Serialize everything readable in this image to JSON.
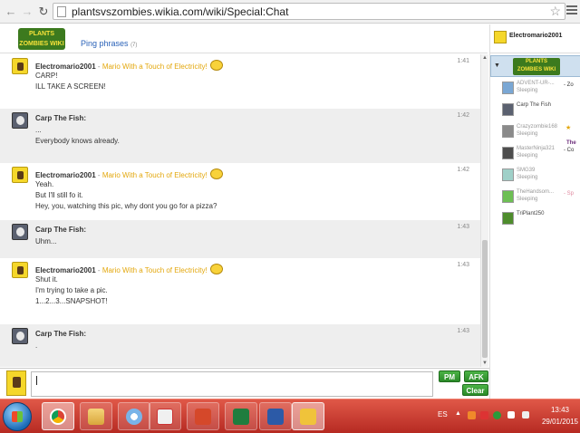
{
  "browser": {
    "url": "plantsvszombies.wikia.com/wiki/Special:Chat"
  },
  "header": {
    "logo_text_1": "PLANTS",
    "logo_text_2": "ZOMBIES WIKI",
    "ping_label": "Ping phrases",
    "ping_count": "(7)"
  },
  "messages": [
    {
      "user": "Electromario2001",
      "status": "Mario With a Touch of Electricity!",
      "time": "1:41",
      "lines": [
        "CARP!",
        "ILL TAKE A SCREEN!"
      ],
      "avatar": "mario-avatar",
      "shaded": false
    },
    {
      "user": "Carp The Fish:",
      "status": "",
      "time": "1:42",
      "lines": [
        "...",
        "Everybody knows already."
      ],
      "avatar": "carp-avatar",
      "shaded": true
    },
    {
      "user": "Electromario2001",
      "status": "Mario With a Touch of Electricity!",
      "time": "1:42",
      "lines": [
        "Yeah.",
        "But I'll still fo it.",
        "Hey, you, watching this pic, why dont you go for a pizza?"
      ],
      "avatar": "mario-avatar",
      "shaded": false
    },
    {
      "user": "Carp The Fish:",
      "status": "",
      "time": "1:43",
      "lines": [
        "Uhm..."
      ],
      "avatar": "carp-avatar",
      "shaded": true
    },
    {
      "user": "Electromario2001",
      "status": "Mario With a Touch of Electricity!",
      "time": "1:43",
      "lines": [
        "Shut it.",
        "I'm trying to take a pic.",
        "1...2...3...SNAPSHOT!"
      ],
      "avatar": "mario-avatar",
      "shaded": false
    },
    {
      "user": "Carp The Fish:",
      "status": "",
      "time": "1:43",
      "lines": [
        "."
      ],
      "avatar": "carp-avatar",
      "shaded": true
    }
  ],
  "input": {
    "value": "",
    "pm_label": "PM",
    "afk_label": "AFK",
    "clear_label": "Clear"
  },
  "sidebar": {
    "me_name": "Electromario2001",
    "room_logo_1": "PLANTS",
    "room_logo_2": "ZOMBIES WIKI",
    "users": [
      {
        "name": "ADVENT-UR-...",
        "state": "Sleeping",
        "extra": "- Zo",
        "extra_color": "#333333",
        "faded": true,
        "color": "#7aa7d4"
      },
      {
        "name": "Carp The Fish",
        "state": "",
        "extra": "",
        "extra_color": "#333333",
        "faded": false,
        "color": "#5b6170"
      },
      {
        "name": "Crazyzombie168",
        "state": "Sleeping",
        "extra": "",
        "extra_color": "#333333",
        "faded": true,
        "color": "#8a8a8a"
      },
      {
        "name": "MasterNinja321",
        "state": "Sleeping",
        "extra": "- Co",
        "extra_color": "#333333",
        "faded": true,
        "color": "#4d4d4d"
      },
      {
        "name": "SMG39",
        "state": "Sleeping",
        "extra": "",
        "extra_color": "#333333",
        "faded": true,
        "color": "#9fd0c8"
      },
      {
        "name": "TheHandsom...",
        "state": "Sleeping",
        "extra": "- Sp",
        "extra_color": "#e08aa0",
        "faded": true,
        "color": "#6dbf54"
      },
      {
        "name": "TriPlant250",
        "state": "",
        "extra": "",
        "extra_color": "#333333",
        "faded": false,
        "color": "#4e8c2c"
      }
    ],
    "side_label": "The"
  },
  "taskbar": {
    "lang": "ES",
    "time": "13:43",
    "date": "29/01/2015",
    "apps": [
      "chrome-icon",
      "folder-icon",
      "paint-icon",
      "snipping-icon",
      "powerpoint-icon",
      "excel-icon",
      "word-icon",
      "pvz-icon"
    ]
  }
}
